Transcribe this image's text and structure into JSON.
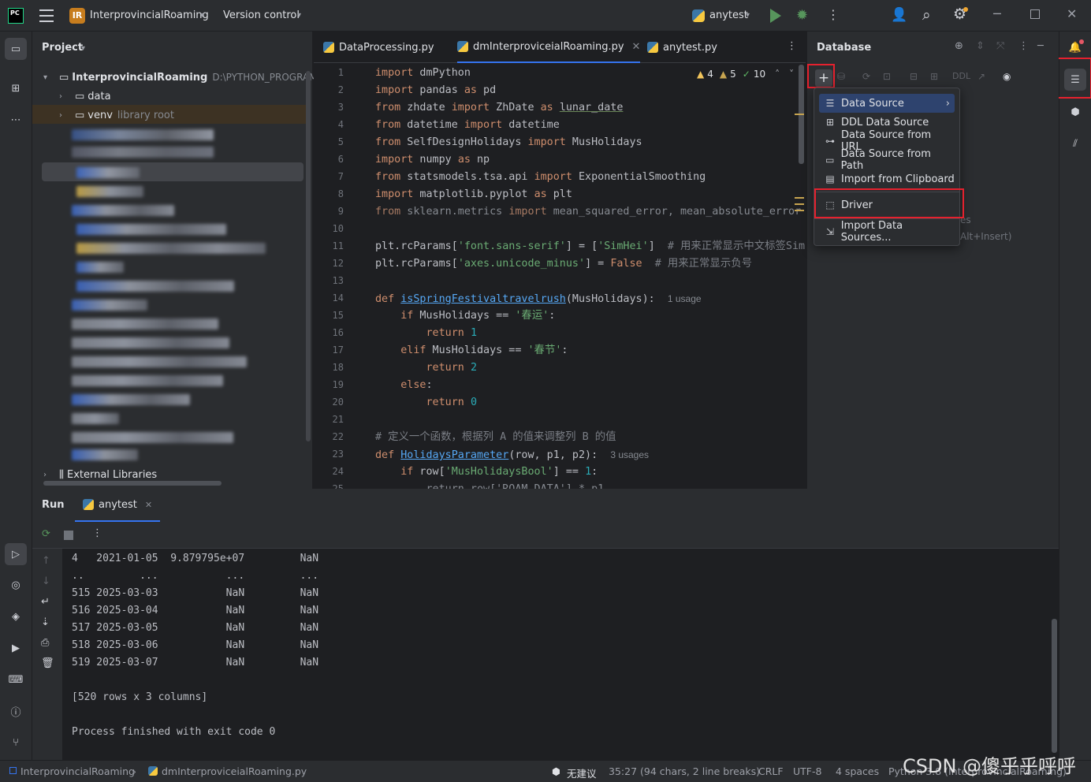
{
  "titlebar": {
    "project_badge": "IR",
    "project_name": "InterprovincialRoaming",
    "vcs": "Version control",
    "run_config": "anytest"
  },
  "project": {
    "title": "Project",
    "root_name": "InterprovincialRoaming",
    "root_path": "D:\\PYTHON_PROGRAM\\Int",
    "items": [
      {
        "name": "data"
      },
      {
        "name": "venv",
        "suffix": "library root"
      }
    ],
    "external": "External Libraries"
  },
  "editor": {
    "tabs": [
      {
        "label": "DataProcessing.py"
      },
      {
        "label": "dmInterproviceialRoaming.py"
      },
      {
        "label": "anytest.py"
      }
    ],
    "inspections": {
      "warn1": "4",
      "warn2": "5",
      "ok": "10"
    },
    "line_numbers": [
      "1",
      "2",
      "3",
      "4",
      "5",
      "6",
      "7",
      "8",
      "9",
      "10",
      "11",
      "12",
      "13",
      "14",
      "15",
      "16",
      "17",
      "18",
      "19",
      "20",
      "21",
      "22",
      "23",
      "24",
      "25"
    ]
  },
  "database": {
    "title": "Database",
    "ddl": "DDL",
    "hint1": "es",
    "hint2": "Alt+Insert)"
  },
  "menu": {
    "items": [
      {
        "label": "Data Source"
      },
      {
        "label": "DDL Data Source"
      },
      {
        "label": "Data Source from URL"
      },
      {
        "label": "Data Source from Path"
      },
      {
        "label": "Import from Clipboard"
      },
      {
        "label": "Driver"
      },
      {
        "label": "Import Data Sources..."
      }
    ]
  },
  "run": {
    "tab_label": "Run",
    "config": "anytest",
    "output": [
      "4   2021-01-05  9.879795e+07         NaN",
      "..         ...           ...         ...",
      "515 2025-03-03           NaN         NaN",
      "516 2025-03-04           NaN         NaN",
      "517 2025-03-05           NaN         NaN",
      "518 2025-03-06           NaN         NaN",
      "519 2025-03-07           NaN         NaN",
      "",
      "[520 rows x 3 columns]",
      "",
      "Process finished with exit code 0"
    ]
  },
  "status": {
    "project": "InterprovincialRoaming",
    "file": "dmInterproviceialRoaming.py",
    "ai": "无建议",
    "position": "35:27 (94 chars, 2 line breaks)",
    "eol": "CRLF",
    "encoding": "UTF-8",
    "indent": "4 spaces",
    "interpreter": "Python 3.8 (InterprovincialRoaming)",
    "watermark": "CSDN @傻乎乎呼呼"
  },
  "colors": {
    "accent": "#3574f0",
    "highlight_red": "#e5212e",
    "selection": "#2e436e"
  }
}
